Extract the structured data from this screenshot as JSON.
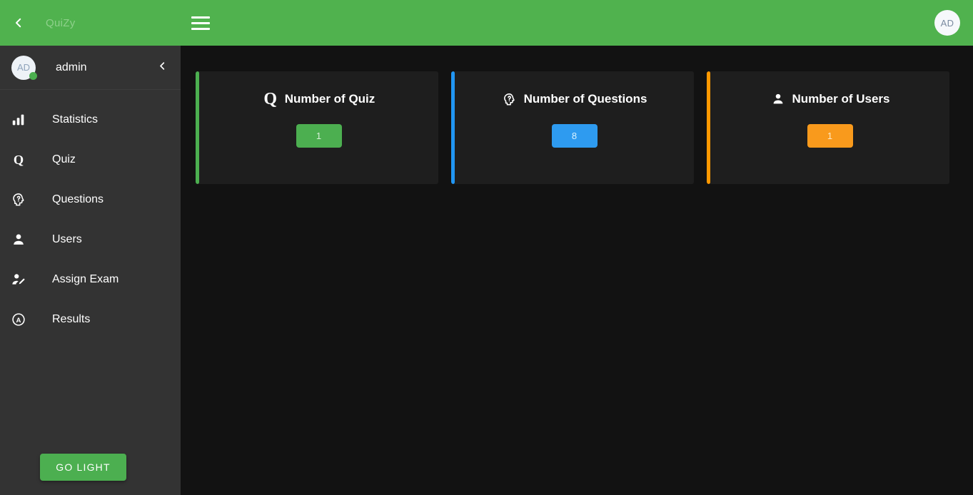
{
  "topbar": {
    "back_icon": "chevron-left-icon",
    "title": "QuiZy",
    "menu_icon": "hamburger-menu-icon",
    "avatar_initials": "AD"
  },
  "sidebar": {
    "user": {
      "avatar_initials": "AD",
      "name": "admin",
      "status": "online",
      "collapse_icon": "chevron-left-icon"
    },
    "items": [
      {
        "label": "Statistics",
        "icon": "bar-chart-icon"
      },
      {
        "label": "Quiz",
        "icon": "letter-q-icon"
      },
      {
        "label": "Questions",
        "icon": "psychology-question-icon"
      },
      {
        "label": "Users",
        "icon": "person-icon"
      },
      {
        "label": "Assign Exam",
        "icon": "person-edit-icon"
      },
      {
        "label": "Results",
        "icon": "circled-a-icon"
      }
    ],
    "theme_button": {
      "label": "GO LIGHT",
      "color": "#4caf50"
    }
  },
  "main": {
    "cards": [
      {
        "title": "Number of Quiz",
        "icon": "letter-q-icon",
        "value": "1",
        "accent": "#4caf50",
        "badge_bg": "#4caf50",
        "badge_text_color": "#d8f0d8"
      },
      {
        "title": "Number of Questions",
        "icon": "psychology-question-icon",
        "value": "8",
        "accent": "#2196f3",
        "badge_bg": "#2e9bf0",
        "badge_text_color": "#d9f2ff"
      },
      {
        "title": "Number of Users",
        "icon": "person-icon",
        "value": "1",
        "accent": "#ff9800",
        "badge_bg": "#f99a1c",
        "badge_text_color": "#ffe9c2"
      }
    ]
  },
  "colors": {
    "header_green": "#50b24e",
    "sidebar_bg": "#333333",
    "page_bg": "#121212",
    "card_bg": "#1e1e1e"
  }
}
